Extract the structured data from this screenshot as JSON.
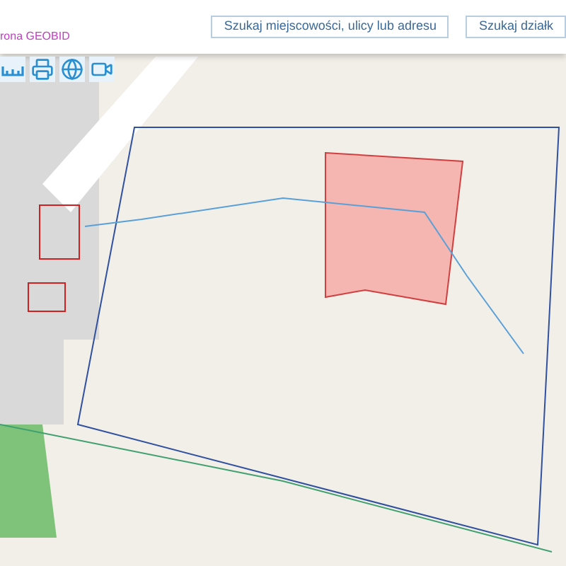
{
  "header": {
    "brand_text": "rona GEOBID",
    "buttons": [
      "Szukaj miejscowości, ulicy lub adresu",
      "Szukaj działk"
    ]
  }
}
